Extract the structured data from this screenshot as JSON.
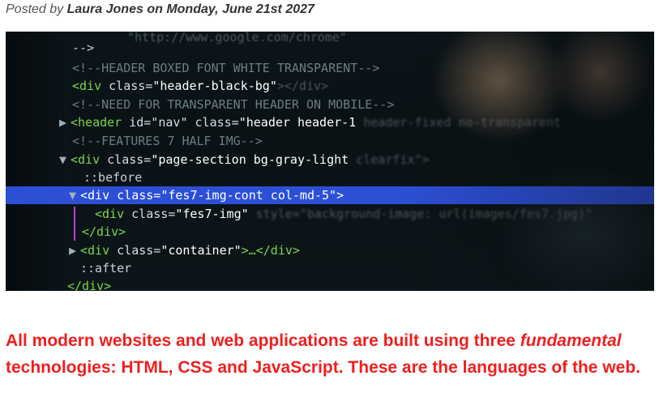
{
  "post": {
    "posted_by_prefix": "Posted by ",
    "author": "Laura Jones",
    "date_text": "on Monday, June 21st 2027"
  },
  "hero_image": {
    "icon": "code-screenshot-image",
    "lines": [
      {
        "prefix": "-->"
      },
      {
        "comment": "<!--HEADER BOXED FONT WHITE TRANSPARENT-->"
      },
      {
        "tag_open": "<div ",
        "attr": "class=",
        "value": "\"header-black-bg\"",
        "tail": "></div>"
      },
      {
        "comment": "<!--NEED FOR TRANSPARENT HEADER ON MOBILE-->"
      },
      {
        "tag_open": "<header ",
        "attr": "id=\"nav\" class=",
        "value": "\"header header-1",
        "tail": " header-fixed no-transparent"
      },
      {
        "comment": "<!--FEATURES 7 HALF IMG-->"
      },
      {
        "tag_open": "<div ",
        "attr": "class=",
        "value": "\"page-section bg-gray-light",
        "tail": " clearfix\">"
      },
      {
        "pseudo": "::before"
      },
      {
        "tag_open": "<div ",
        "attr": "class=",
        "value": "\"fes7-img-cont col-md-5\"",
        "tail": ">"
      },
      {
        "tag_open": "<div ",
        "attr": "class=",
        "value": "\"fes7-img\"",
        "tail": " style=\"background-image: url(images/fes7.jpg)\""
      },
      {
        "tag_close": "</div>"
      },
      {
        "tag_open": "<div ",
        "attr": "class=",
        "value": "\"container\"",
        "tail": ">…</div>"
      },
      {
        "pseudo": "::after"
      },
      {
        "tag_close": "</div>"
      }
    ]
  },
  "body_text": {
    "part1": "All modern websites and web applications are built using three ",
    "emphasis": "fundamental",
    "part2": " technologies: HTML, CSS and JavaScript. These are the languages of the web."
  }
}
